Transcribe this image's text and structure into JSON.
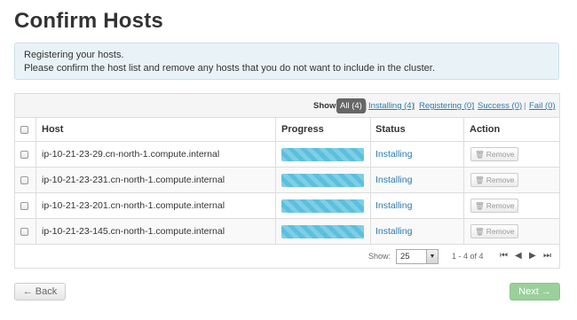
{
  "page": {
    "title": "Confirm Hosts"
  },
  "alert": {
    "line1": "Registering your hosts.",
    "line2": "Please confirm the host list and remove any hosts that you do not want to include in the cluster."
  },
  "filter": {
    "label": "Show:",
    "options": [
      "All (4)",
      "Installing (4)",
      "Registering (0)",
      "Success (0)",
      "Fail (0)"
    ],
    "separator": "|"
  },
  "table": {
    "columns": [
      "Host",
      "Progress",
      "Status",
      "Action"
    ],
    "rows": [
      {
        "host": "ip-10-21-23-29.cn-north-1.compute.internal",
        "progress": 1.0,
        "status": "Installing",
        "action": "Remove"
      },
      {
        "host": "ip-10-21-23-231.cn-north-1.compute.internal",
        "progress": 1.0,
        "status": "Installing",
        "action": "Remove"
      },
      {
        "host": "ip-10-21-23-201.cn-north-1.compute.internal",
        "progress": 1.0,
        "status": "Installing",
        "action": "Remove"
      },
      {
        "host": "ip-10-21-23-145.cn-north-1.compute.internal",
        "progress": 1.0,
        "status": "Installing",
        "action": "Remove"
      }
    ]
  },
  "pagination": {
    "show_label": "Show:",
    "page_size": "25",
    "range": "1 - 4 of 4",
    "icons": [
      "first-page-icon",
      "previous-page-icon",
      "next-page-icon",
      "last-page-icon"
    ]
  },
  "buttons": {
    "back": "← Back",
    "next": "Next →"
  },
  "colors": {
    "progress": "#5bc0de",
    "link": "#2a7ab0",
    "next_button": "#9ad09a",
    "active_filter": "#666666"
  }
}
